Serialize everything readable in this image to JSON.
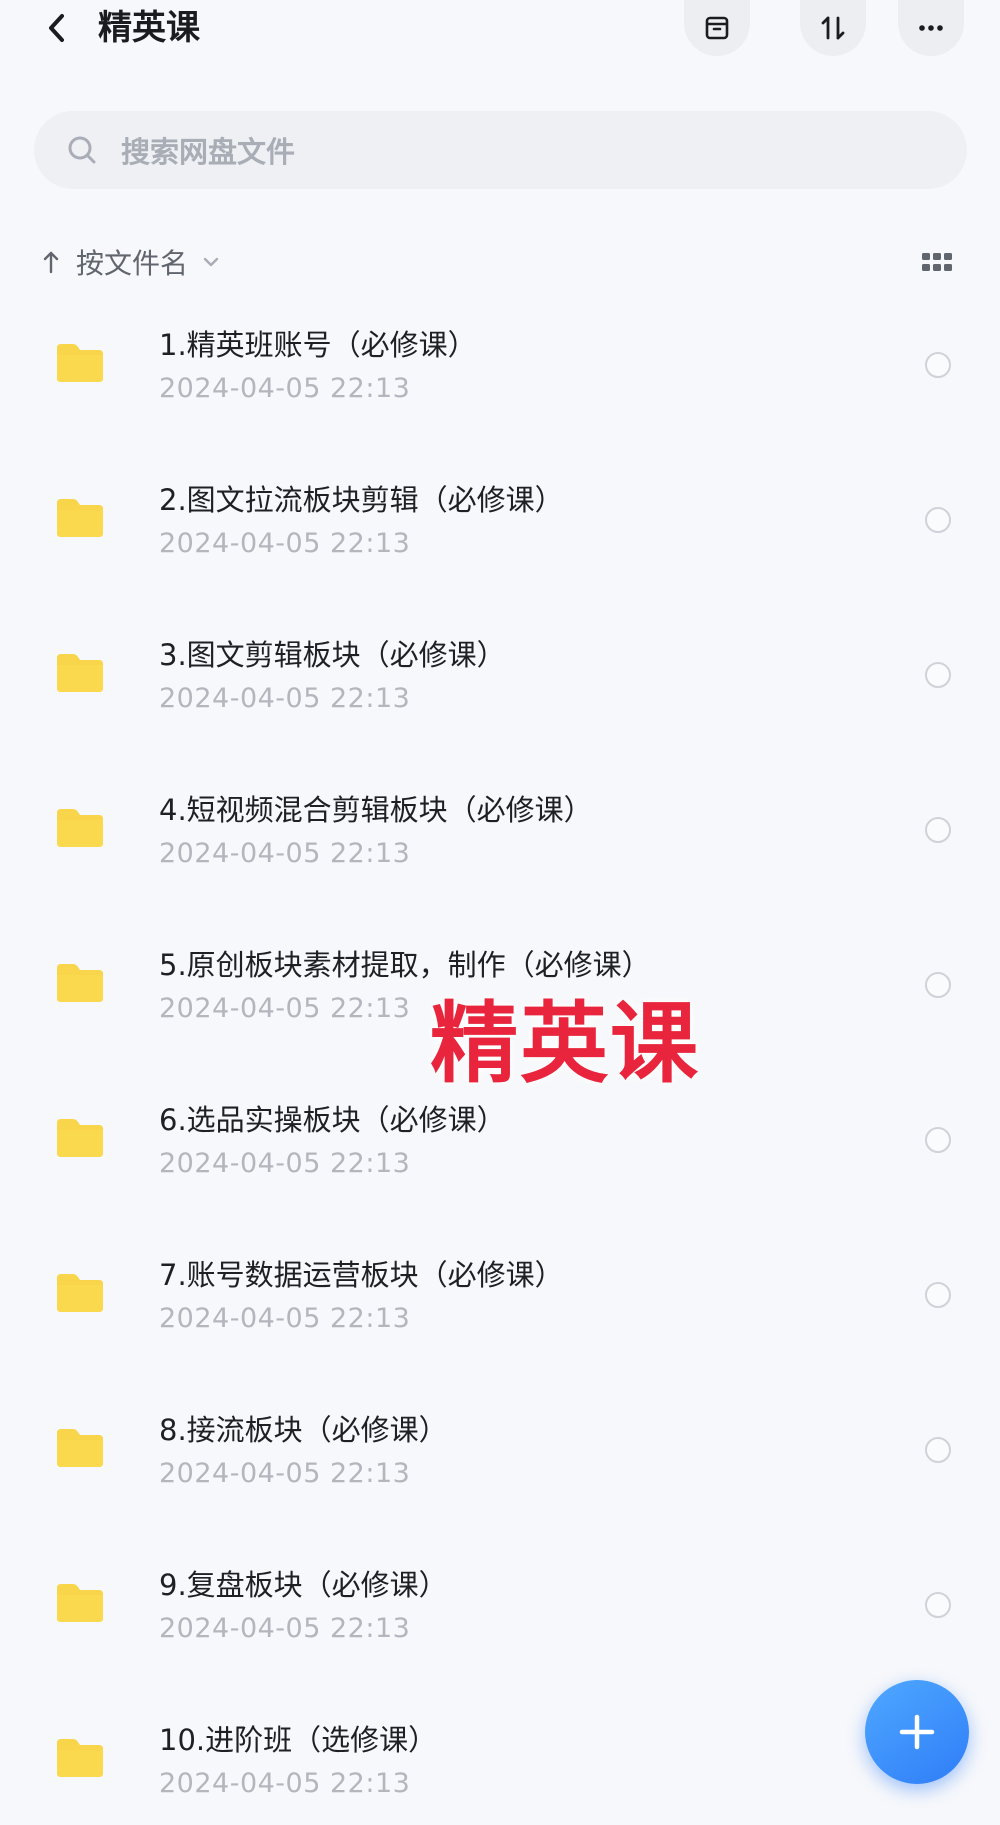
{
  "header": {
    "title": "精英课",
    "back_icon": "chevron-left-icon",
    "actions": [
      "archive-icon",
      "sort-swap-icon",
      "more-icon"
    ]
  },
  "search": {
    "placeholder": "搜索网盘文件"
  },
  "sort": {
    "label": "按文件名",
    "direction_icon": "arrow-up-icon",
    "view_icon": "grid-view-icon"
  },
  "files": [
    {
      "name": "1.精英班账号（必修课）",
      "date": "2024-04-05  22:13"
    },
    {
      "name": "2.图文拉流板块剪辑（必修课）",
      "date": "2024-04-05  22:13"
    },
    {
      "name": "3.图文剪辑板块（必修课）",
      "date": "2024-04-05  22:13"
    },
    {
      "name": "4.短视频混合剪辑板块（必修课）",
      "date": "2024-04-05  22:13"
    },
    {
      "name": "5.原创板块素材提取，制作（必修课）",
      "date": "2024-04-05  22:13"
    },
    {
      "name": "6.选品实操板块（必修课）",
      "date": "2024-04-05  22:13"
    },
    {
      "name": "7.账号数据运营板块（必修课）",
      "date": "2024-04-05  22:13"
    },
    {
      "name": "8.接流板块（必修课）",
      "date": "2024-04-05  22:13"
    },
    {
      "name": "9.复盘板块（必修课）",
      "date": "2024-04-05  22:13"
    },
    {
      "name": "10.进阶班（选修课）",
      "date": "2024-04-05  22:13"
    }
  ],
  "watermark": "精英课",
  "colors": {
    "folder": "#f8d54a",
    "accent": "#2f7df8",
    "watermark": "#e8253c"
  },
  "fab_icon": "plus-icon"
}
